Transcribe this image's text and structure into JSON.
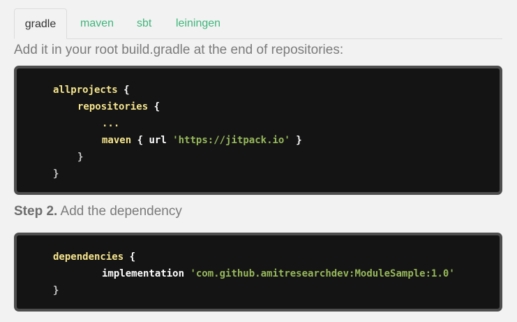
{
  "tabs": [
    {
      "label": "gradle",
      "active": true
    },
    {
      "label": "maven",
      "active": false
    },
    {
      "label": "sbt",
      "active": false
    },
    {
      "label": "leiningen",
      "active": false
    }
  ],
  "instruction": "Add it in your root build.gradle at the end of repositories:",
  "code_block_1": {
    "line1_keyword": "allprojects",
    "line1_brace": "{",
    "line2_keyword": "repositories",
    "line2_brace": "{",
    "line3_ellipsis": "...",
    "line4_keyword": "maven",
    "line4_open": "{",
    "line4_url_key": "url",
    "line4_url_value": "'https://jitpack.io'",
    "line4_close": "}",
    "line5_brace": "}",
    "line6_brace": "}"
  },
  "step2": {
    "label": "Step 2.",
    "text": " Add the dependency"
  },
  "code_block_2": {
    "line1_keyword": "dependencies",
    "line1_brace": "{",
    "line2_keyword": "implementation",
    "line2_value": "'com.github.amitresearchdev:ModuleSample:1.0'",
    "line3_brace": "}"
  },
  "colors": {
    "background": "#f2f2f2",
    "tab_link": "#3fb67c",
    "code_bg": "#141414",
    "code_border": "#4e4e4e",
    "keyword": "#f6e58d",
    "string": "#96b85a"
  }
}
